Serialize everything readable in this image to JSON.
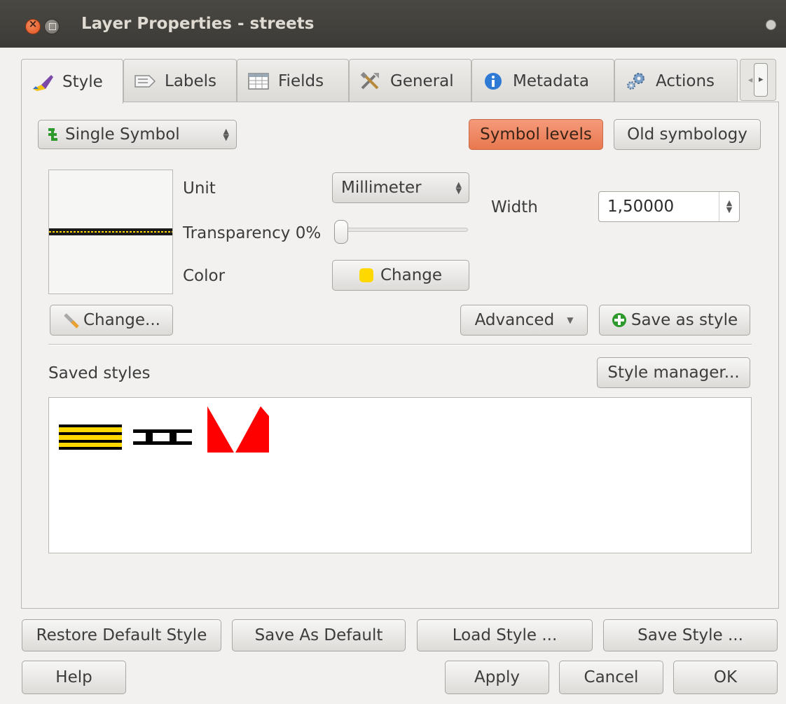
{
  "window": {
    "title": "Layer Properties - streets"
  },
  "tabs": [
    {
      "label": "Style",
      "icon": "paintbrush-icon"
    },
    {
      "label": "Labels",
      "icon": "label-icon"
    },
    {
      "label": "Fields",
      "icon": "table-icon"
    },
    {
      "label": "General",
      "icon": "tools-icon"
    },
    {
      "label": "Metadata",
      "icon": "info-icon"
    },
    {
      "label": "Actions",
      "icon": "gears-icon"
    }
  ],
  "style": {
    "renderer": "Single Symbol",
    "symbol_levels": "Symbol levels",
    "old_symbology": "Old symbology",
    "unit_label": "Unit",
    "unit_value": "Millimeter",
    "width_label": "Width",
    "width_value": "1,50000",
    "transparency_label": "Transparency 0%",
    "transparency": 0,
    "color_label": "Color",
    "color_change": "Change",
    "symbol_color": "#ffd800",
    "change_symbol": "Change...",
    "advanced": "Advanced",
    "save_as_style": "Save as style",
    "saved_styles_label": "Saved styles",
    "style_manager": "Style manager..."
  },
  "buttons": {
    "restore_default": "Restore Default Style",
    "save_as_default": "Save As Default",
    "load_style": "Load Style ...",
    "save_style": "Save Style ...",
    "help": "Help",
    "apply": "Apply",
    "cancel": "Cancel",
    "ok": "OK"
  },
  "colors": {
    "accent": "#e9784f",
    "titlebar": "#3c3b37"
  }
}
